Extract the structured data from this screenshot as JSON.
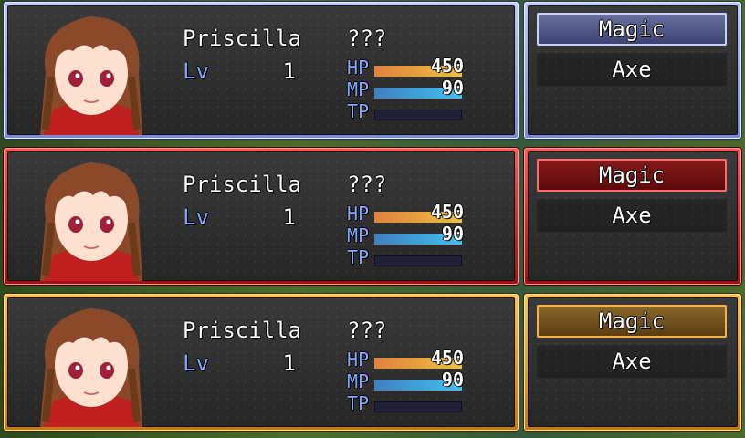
{
  "party": [
    {
      "name": "Priscilla",
      "class_name": "???",
      "level_label": "Lv",
      "level": "1",
      "hp_label": "HP",
      "hp": "450",
      "hp_ratio": 1.0,
      "mp_label": "MP",
      "mp": "90",
      "mp_ratio": 1.0,
      "tp_label": "TP",
      "tp_ratio": 0.0,
      "frame_color": "#9aa6ee",
      "commands": [
        "Magic",
        "Axe"
      ]
    },
    {
      "name": "Priscilla",
      "class_name": "???",
      "level_label": "Lv",
      "level": "1",
      "hp_label": "HP",
      "hp": "450",
      "hp_ratio": 1.0,
      "mp_label": "MP",
      "mp": "90",
      "mp_ratio": 1.0,
      "tp_label": "TP",
      "tp_ratio": 0.0,
      "frame_color": "#d42020",
      "commands": [
        "Magic",
        "Axe"
      ]
    },
    {
      "name": "Priscilla",
      "class_name": "???",
      "level_label": "Lv",
      "level": "1",
      "hp_label": "HP",
      "hp": "450",
      "hp_ratio": 1.0,
      "mp_label": "MP",
      "mp": "90",
      "mp_ratio": 1.0,
      "tp_label": "TP",
      "tp_ratio": 0.0,
      "frame_color": "#e89a2a",
      "commands": [
        "Magic",
        "Axe"
      ]
    }
  ],
  "colors": {
    "system_text": "#84aaff",
    "hp_gauge": "#f0a040",
    "mp_gauge": "#40a0e0",
    "tp_gauge": "#20203a"
  },
  "icons": {
    "portrait": "priscilla-face-portrait"
  }
}
